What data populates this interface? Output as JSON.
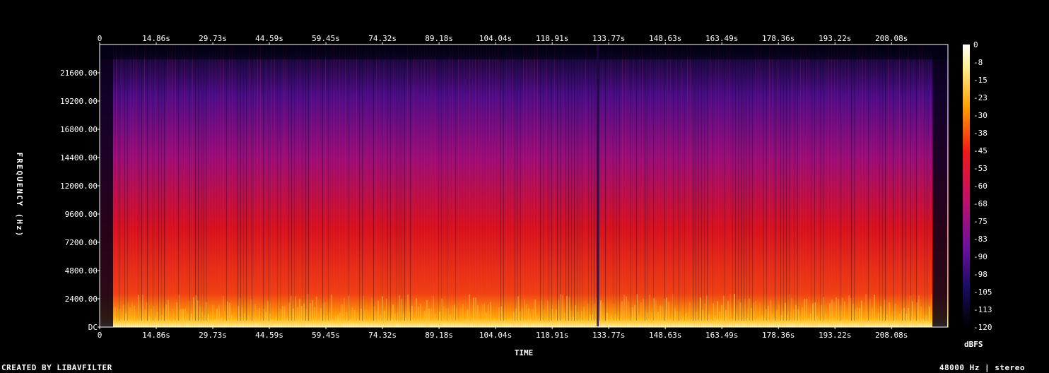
{
  "chart_data": {
    "type": "heatmap",
    "xlabel": "TIME",
    "ylabel": "FREQUENCY (Hz)",
    "x_ticks": [
      "0",
      "14.86s",
      "29.73s",
      "44.59s",
      "59.45s",
      "74.32s",
      "89.18s",
      "104.04s",
      "118.91s",
      "133.77s",
      "148.63s",
      "163.49s",
      "178.36s",
      "193.22s",
      "208.08s"
    ],
    "x_tick_values": [
      0,
      14.86,
      29.73,
      44.59,
      59.45,
      74.32,
      89.18,
      104.04,
      118.91,
      133.77,
      148.63,
      163.49,
      178.36,
      193.22,
      208.08
    ],
    "xlim": [
      0,
      222.9
    ],
    "y_ticks": [
      "DC",
      "2400.00",
      "4800.00",
      "7200.00",
      "9600.00",
      "12000.00",
      "14400.00",
      "16800.00",
      "19200.00",
      "21600.00"
    ],
    "y_tick_values": [
      0,
      2400,
      4800,
      7200,
      9600,
      12000,
      14400,
      16800,
      19200,
      21600
    ],
    "ylim": [
      0,
      24000
    ],
    "colorbar": {
      "label": "dBFS",
      "ticks": [
        "0",
        "-8",
        "-15",
        "-23",
        "-30",
        "-38",
        "-45",
        "-53",
        "-60",
        "-68",
        "-75",
        "-83",
        "-90",
        "-98",
        "-105",
        "-113",
        "-120"
      ],
      "range": [
        -120,
        0
      ]
    },
    "colors": {
      "low": "#000010",
      "mid_low": "#3a0a7a",
      "mid": "#a0109a",
      "mid_high": "#e0101a",
      "high": "#ff8a00",
      "peak": "#fffff0"
    }
  },
  "footer": {
    "left": "CREATED BY LIBAVFILTER",
    "right": "48000 Hz | stereo"
  }
}
